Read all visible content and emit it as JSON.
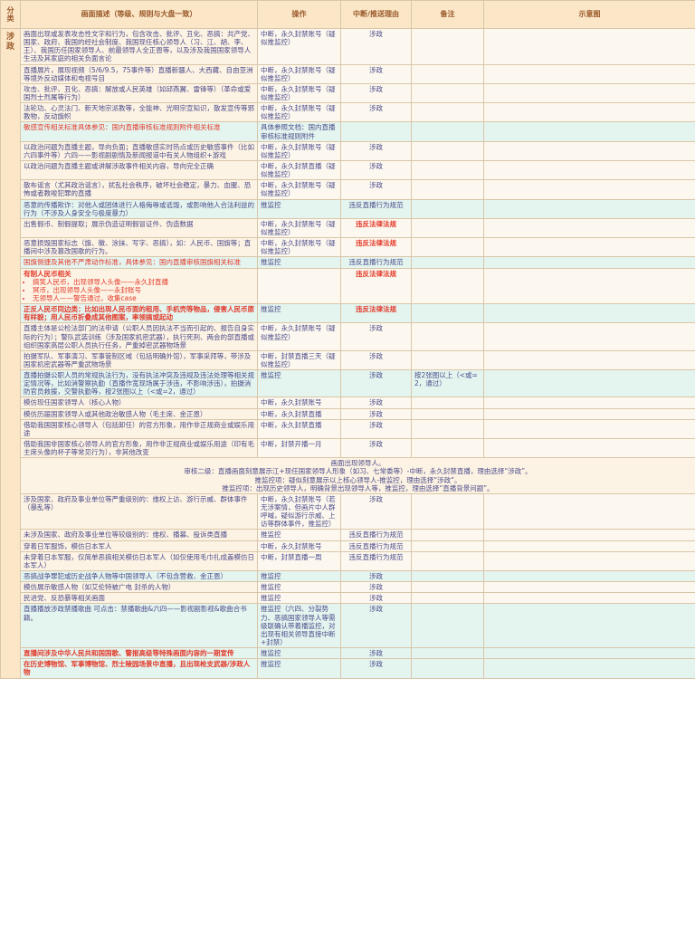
{
  "headers": {
    "category": "分类",
    "description": "画面描述（等级、规则与大盘一致）",
    "operation": "操作",
    "reason": "中断/推送理由",
    "remarks": "备注",
    "illustration": "示意图"
  },
  "category": "涉政",
  "rows": [
    {
      "d": "画面出现或发表攻击性文字和行为，包含攻击、批评、丑化、恶搞：共产党、国家、政府、我国的经社会制度、我国现任核心领导人（习、江、胡、李、王）、我国历任国家领导人、前最领导人全正恩等，以及涉及我国国家领导人生活及其家庭的相关负面言论",
      "o": "中断，永久封禁账号（疑似推监控）",
      "r": "涉政"
    },
    {
      "d": "直播展片，展现视频（5/6/9.5，75事件等）直播新疆人、大西藏、自由亚洲等境外反动媒体和电视号目",
      "o": "中断，永久封禁账号（疑似推监控）",
      "r": "涉政"
    },
    {
      "d": "攻击、批评、丑化、恶搞：解放或人民英雄（如邱燕翼、雷锋等）（革命或爱国烈士烈属等行为）",
      "o": "中断，永久封禁账号（疑似推监控）",
      "r": "涉政"
    },
    {
      "d": "法轮功、心灵法门、新天地宗派教等，全能神、光明宗宣知识，散发宣传等邪教物，反动旗帜",
      "o": "中断，永久封禁账号（疑似推监控）",
      "r": "涉政"
    },
    {
      "d": "敏感宣传相关标准具体参见：国内直播审核标准规则附件相关标准",
      "o": "具体参照文档：国内直播审核标准规则附件",
      "r": "",
      "hl": true,
      "red": true
    },
    {
      "d": "以政治问题为直播主题，导向负面；直播敏感实时热点或历史敏感事件（比如六四事件等）六四——影视剧剧情及新闻报道中有关人物组织+游戏",
      "o": "中断，永久封禁账号（疑似推监控）",
      "r": "涉政"
    },
    {
      "d": "以政治问题为直播主题或讲解涉政事件相关内容，导向完全正确",
      "o": "中断，永久封禁直播（疑似推监控）",
      "r": "涉政"
    },
    {
      "d": "散布谣言（尤其政治谣言），扰乱社会秩序，破坏社会稳定，暴力、血腥、恐怖或者教唆犯罪的直播",
      "o": "中断，永久封禁账号（疑似推监控）",
      "r": "涉政"
    },
    {
      "d": "恶意的传播欺诈：对他人或团体进行人格侮辱或诋毁，或影响他人合法利益的行为（不涉及人身安全与极度暴力）",
      "o": "推监控",
      "r": "违反直播行为规范",
      "hl": true
    },
    {
      "d": "出售假币、制假提取；展示伪造证明假冒证件、伪造数据",
      "o": "中断，永久封禁账号（疑似推监控）",
      "r": "违反法律法规",
      "rred": true
    },
    {
      "d": "恶意损毁国家标志（旗、徽、涂抹、写字、恶搞），如：人民币、国旗等；直播间中涉及篡改国歌的行为。",
      "o": "中断，永久封禁账号（疑似推监控）",
      "r": "违反法律法规",
      "rred": true,
      "dmixed": true
    },
    {
      "d": "国旗侧捷及其他不严肃动作标准，具体参见：国内直播审核国旗相关标准",
      "o": "推监控",
      "r": "违反直播行为规范",
      "hl": true,
      "red": true
    },
    {
      "d": "有制人民币相关",
      "list": [
        "搞笑人民币，出现领导人头像——永久封直播",
        "冥币，出现领导人头像——永封账号",
        "无领导人——警告通过，收集case"
      ],
      "o": "",
      "r": "违反法律法规",
      "rred": true,
      "dred": true
    },
    {
      "d": "正反人民币同边类：比如出现人民币面的租用、手机壳等物品，侵害人民币原有样貌；用人民币折叠成其他图案，率领搞或起动",
      "o": "推监控",
      "r": "违反法律法规",
      "rred": true,
      "hl": true,
      "dred": true
    },
    {
      "d": "直播主体是公检法部门的法申请（公职人员因执法不当而引起的、报告自身实际的行为）；警队武装训练（涉及国家机密武器），执行死刑、两会的部直播或组织国家高层公职人员执行任务，严重掉密武器物场景",
      "o": "中断，永久封禁账号（疑似推监控）",
      "r": "涉政"
    },
    {
      "d": "拍摄军队、军事演习、军事管制区域（包括明确外馆），军事采拜等，带涉及国家机密武器等严重武物场景",
      "o": "中断，封禁直播三天（疑似推监控）",
      "r": "涉政"
    },
    {
      "d": "直播拍摄公职人员的常规执法行为，没有执法冲突及违规及违法处理等相关规定情况等，比如消警察执勤（直播作宽现场属于涉违，不影响涉违），拍摄消防官员救援，交警执勤等，按2张图以上（<或=2，通过）",
      "o": "推监控",
      "r": "涉政",
      "n": "按2张图以上（<或=2，通过）",
      "hl": true
    },
    {
      "d": "模仿现任国家领导人（核心人物）",
      "o": "中断，永久封禁账号",
      "r": "涉政"
    },
    {
      "d": "模仿历届国家领导人或其他政治敏感人物（毛主席、金正恩）",
      "o": "中断，永久封禁直播",
      "r": "涉政"
    },
    {
      "d": "借助我国国家核心领导人（包括卸任）的官方形象，用作非正规商业或娱乐用途",
      "o": "中断，永久封禁直播",
      "r": "涉政",
      "dmixed2": true
    },
    {
      "d": "借助我国非国家核心领导人的官方形象，用作非正规商业或娱乐用途（印有毛主席头像的杯子等常见行为），非其他改变",
      "o": "中断，封禁开播一月",
      "r": "涉政"
    }
  ],
  "span_block": {
    "title": "画面出现领导人。",
    "line1": "审核二级：直播画面刻意展示江+现任国家领导人形象（如习、七常委等）-中断，永久封禁直播，理由选择“涉政”。",
    "line2": "推监控项：疑似刻意展示以上核心领导人-推监控，理由选择“涉政”。",
    "line3": "推监控项：出现历史领导人，明确背景出现领导人等，推监控，理由选择“直播背景问题”。"
  },
  "rows2": [
    {
      "d": "涉及国家、政府及事业单位等严重级别的：维权上访、游行示威、群体事件（暴乱等）",
      "o": "中断，永久封禁账号（若无涉案情，但画片中人群呼喊，疑似游行示威、上访等群体事件，推监控）",
      "r": "涉政"
    },
    {
      "d": "未涉及国家、政府及事业单位等较级别的：维权、播募、投诉类直播",
      "o": "推监控",
      "r": "违反直播行为规范"
    },
    {
      "d": "穿着日军服饰，模仿日本军人",
      "o": "中断，永久封禁账号",
      "r": "违反直播行为规范"
    },
    {
      "d": "未穿着日本军服，仅简单恶搞相关模仿日本军人（如仅使用毛巾扎成盖模仿日本军人）",
      "o": "中断，封禁直播一周",
      "r": "违反直播行为规范"
    },
    {
      "d": "恶搞战争罪犯或历史战争人物等中国领导人（不包含营救、金正恩）",
      "o": "推监控",
      "r": "涉政",
      "hl": true
    },
    {
      "d": "模仿展示敏感人物（如艾伦特被广电 封杀的人物）",
      "o": "推监控",
      "r": "涉政"
    },
    {
      "d": "民进党、反恐暴等相关画面",
      "o": "推监控",
      "r": "涉政"
    },
    {
      "d": "直播播放涉政禁播歌曲 可点击：禁播歌曲&六四——影视剧影视&歌曲合书籍。",
      "o": "推监控（六四、分裂势力、恶搞国家领导人等需级联确认带着播监控，对出现有相关领导直接中断+封禁）",
      "r": "涉政",
      "hl": true
    },
    {
      "d": "直播间涉及中华人民共和国国歌、警报高级等特殊画面内容的一期宣传",
      "o": "推监控",
      "r": "涉政",
      "hl": true,
      "dred": true
    },
    {
      "d": "在历史博物馆、军事博物馆、烈士陵园场景中直播，且出现枪支武器/涉政人物",
      "o": "推监控",
      "r": "涉政",
      "hl": true,
      "dred": true
    }
  ]
}
